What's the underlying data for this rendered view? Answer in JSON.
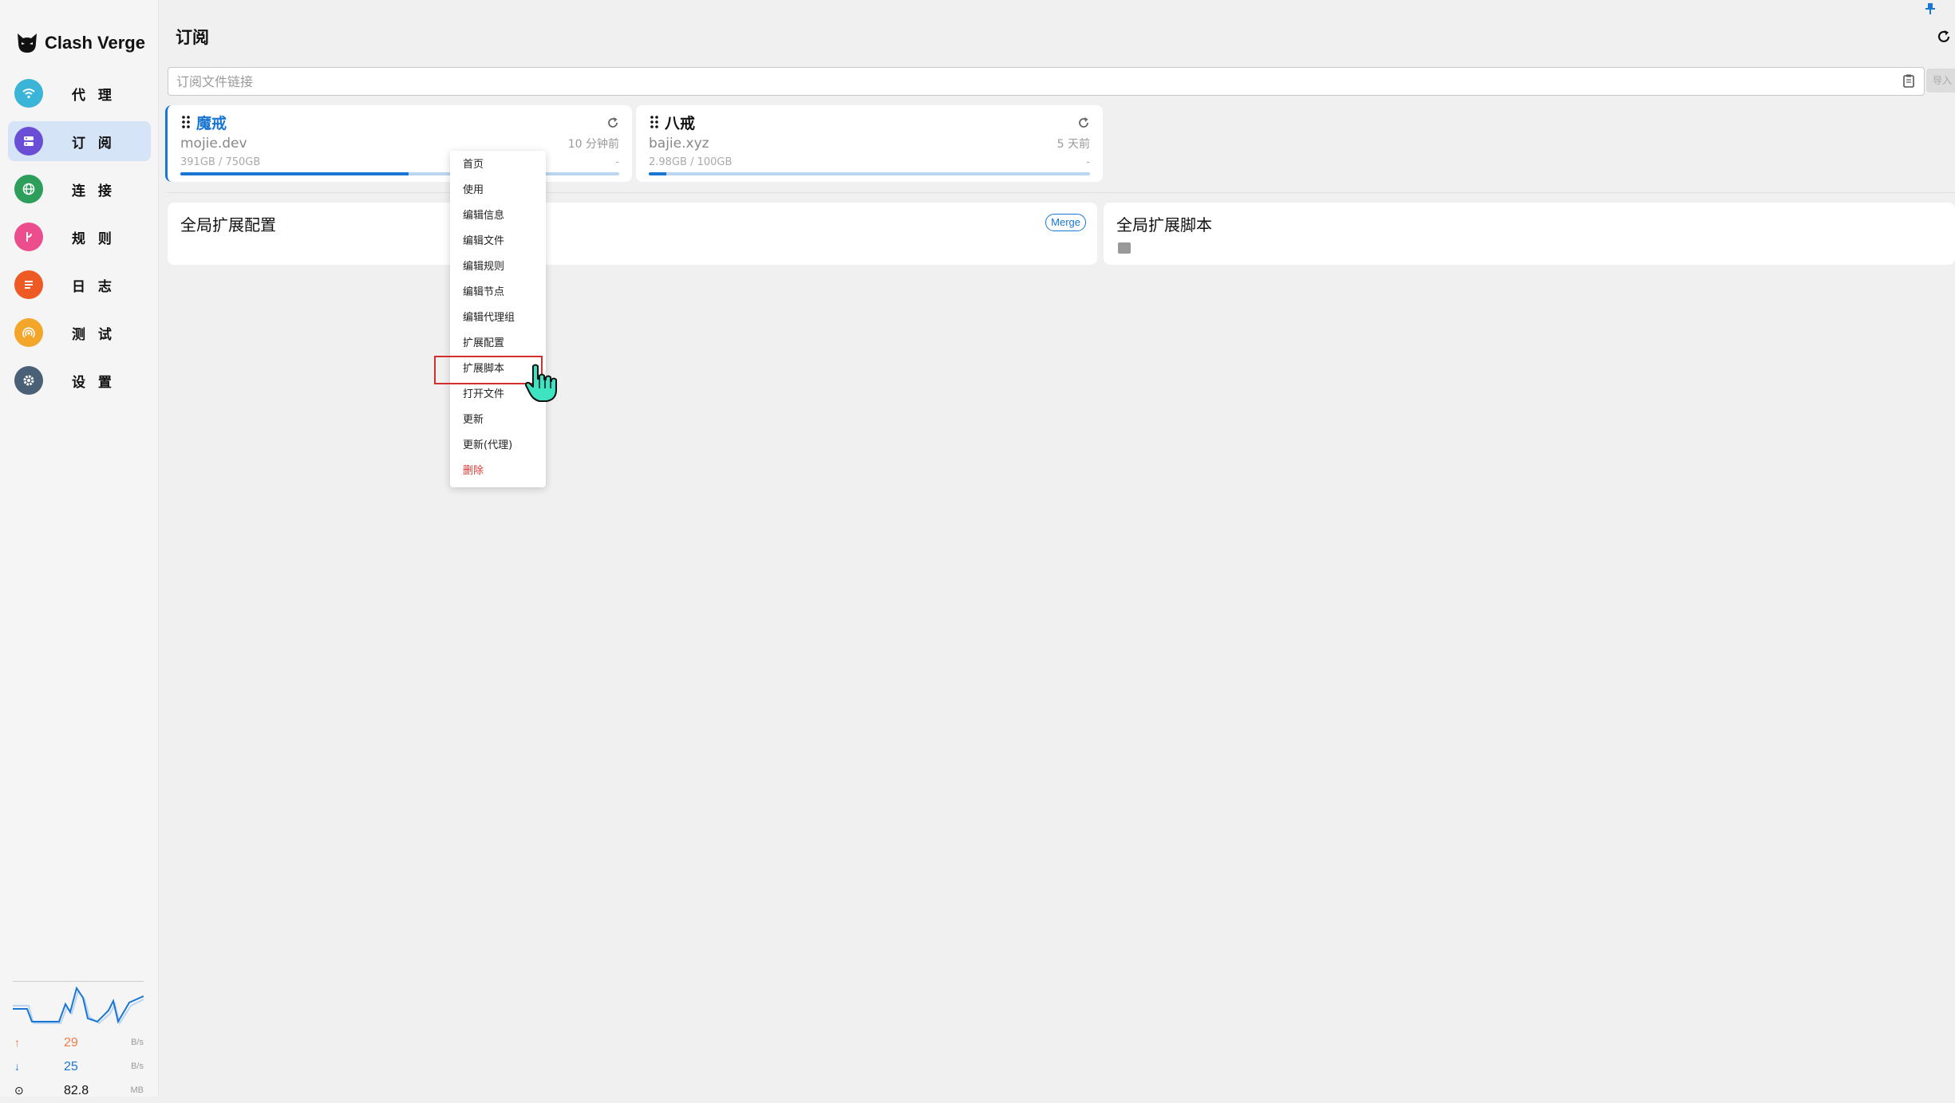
{
  "app": {
    "name": "Clash Verge"
  },
  "sidebar": {
    "items": [
      {
        "label": "代 理",
        "icon": "wifi-icon",
        "color": "#3ab5d8",
        "active": false
      },
      {
        "label": "订 阅",
        "icon": "server-icon",
        "color": "#6a4fd6",
        "active": true
      },
      {
        "label": "连 接",
        "icon": "globe-icon",
        "color": "#2e9e5b",
        "active": false
      },
      {
        "label": "规 则",
        "icon": "fork-icon",
        "color": "#ec4d8c",
        "active": false
      },
      {
        "label": "日 志",
        "icon": "log-icon",
        "color": "#ee5a24",
        "active": false
      },
      {
        "label": "测 试",
        "icon": "signal-icon",
        "color": "#f4a62a",
        "active": false
      },
      {
        "label": "设 置",
        "icon": "gear-icon",
        "color": "#4a6076",
        "active": false
      }
    ]
  },
  "traffic": {
    "upload": {
      "value": "29",
      "unit": "B/s",
      "color": "#f07c4c"
    },
    "download": {
      "value": "25",
      "unit": "B/s",
      "color": "#1976d2"
    },
    "memory": {
      "value": "82.8",
      "unit": "MB"
    }
  },
  "header": {
    "title": "订阅"
  },
  "import": {
    "placeholder": "订阅文件链接",
    "button_label": "导入"
  },
  "profiles": [
    {
      "name": "魔戒",
      "host": "mojie.dev",
      "updated": "10 分钟前",
      "usage": "391GB / 750GB",
      "expire": "-",
      "progress": 0.52,
      "selected": true
    },
    {
      "name": "八戒",
      "host": "bajie.xyz",
      "updated": "5 天前",
      "usage": "2.98GB / 100GB",
      "expire": "-",
      "progress": 0.04,
      "selected": false
    }
  ],
  "global": {
    "config_title": "全局扩展配置",
    "config_badge": "Merge",
    "script_title": "全局扩展脚本"
  },
  "context_menu": {
    "items": [
      "首页",
      "使用",
      "编辑信息",
      "编辑文件",
      "编辑规则",
      "编辑节点",
      "编辑代理组",
      "扩展配置",
      "扩展脚本",
      "打开文件",
      "更新",
      "更新(代理)",
      "删除"
    ],
    "highlighted": "扩展脚本",
    "danger": "删除"
  },
  "colors": {
    "accent": "#1976d2",
    "danger": "#e53935",
    "highlight_border": "#d32f2f"
  }
}
